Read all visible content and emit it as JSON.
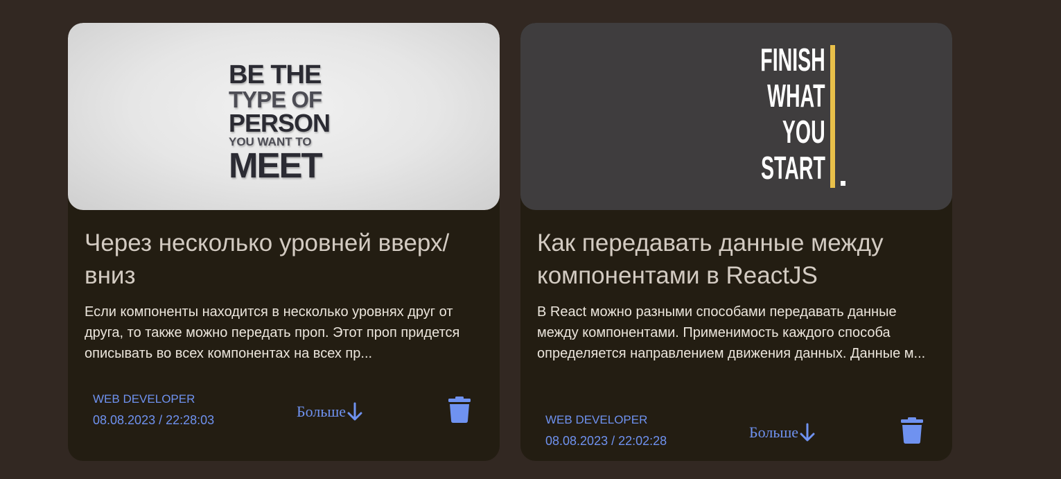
{
  "posts": [
    {
      "cover": {
        "lines": [
          "BE THE",
          "TYPE OF",
          "PERSON",
          "YOU WANT TO",
          "MEET"
        ]
      },
      "title": "Через несколько уровней вверх/ вниз",
      "excerpt": "Если компоненты находится в несколько уровнях друг от друга, то также можно передать проп. Этот проп придется описывать во всех компонентах на всех пр...",
      "author": "WEB DEVELOPER",
      "date": "08.08.2023 / 22:28:03",
      "more_label": "Больше",
      "more_icon": "arrow-down-icon",
      "delete_icon": "trash-icon"
    },
    {
      "cover": {
        "lines": [
          "FINISH",
          "WHAT",
          "YOU",
          "START"
        ]
      },
      "title": "Как передавать данные между компонентами в ReactJS",
      "excerpt": "В React можно разными способами передавать данные между компонентами. Применимость каждого способа определяется направлением движения данных. Данные м...",
      "author": "WEB DEVELOPER",
      "date": "08.08.2023 / 22:02:28",
      "more_label": "Больше",
      "more_icon": "arrow-down-icon",
      "delete_icon": "trash-icon"
    }
  ],
  "colors": {
    "page_background": "#322822",
    "card_background": "#231d12",
    "accent": "#6f92f0",
    "title": "#d3cbc2",
    "text": "#ece6dd",
    "poster_bar": "#e9c04a"
  }
}
